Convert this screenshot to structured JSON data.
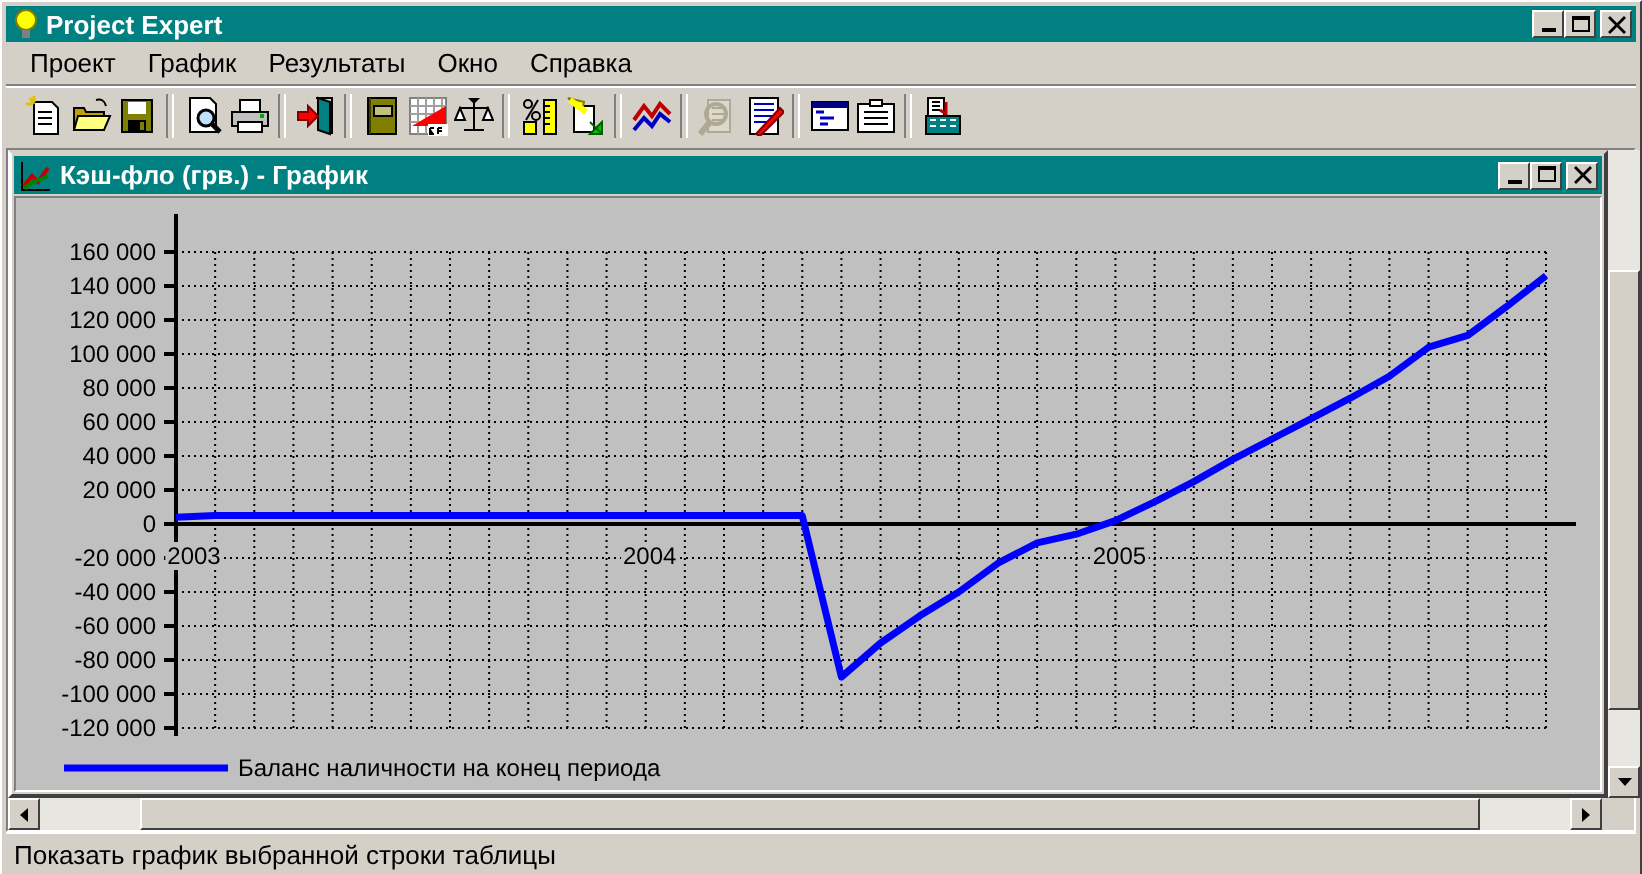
{
  "window": {
    "title": "Project Expert"
  },
  "menu": [
    "Проект",
    "График",
    "Результаты",
    "Окно",
    "Справка"
  ],
  "toolbar": [
    [
      {
        "kind": "new",
        "disabled": false
      },
      {
        "kind": "open",
        "disabled": false
      },
      {
        "kind": "save",
        "disabled": false
      }
    ],
    [
      {
        "kind": "preview",
        "disabled": false
      },
      {
        "kind": "print",
        "disabled": false
      }
    ],
    [
      {
        "kind": "exit",
        "disabled": false
      }
    ],
    [
      {
        "kind": "notebook",
        "disabled": false
      },
      {
        "kind": "gridchart",
        "disabled": false
      },
      {
        "kind": "scales",
        "disabled": false
      }
    ],
    [
      {
        "kind": "percent",
        "disabled": false
      },
      {
        "kind": "docarrow",
        "disabled": false
      }
    ],
    [
      {
        "kind": "linechart",
        "disabled": false
      }
    ],
    [
      {
        "kind": "finddoc",
        "disabled": true
      },
      {
        "kind": "editdoc",
        "disabled": false
      }
    ],
    [
      {
        "kind": "windows",
        "disabled": false
      },
      {
        "kind": "clipboard",
        "disabled": false
      }
    ],
    [
      {
        "kind": "calc",
        "disabled": false
      }
    ]
  ],
  "child_window": {
    "title": "Кэш-фло (грв.) - График",
    "chart_data": {
      "type": "line",
      "categories": [
        "2003",
        null,
        null,
        null,
        null,
        null,
        null,
        null,
        null,
        null,
        null,
        null,
        "2004",
        null,
        null,
        null,
        null,
        null,
        null,
        null,
        null,
        null,
        null,
        null,
        "2005",
        null,
        null,
        null,
        null,
        null,
        null,
        null,
        null,
        null,
        null,
        null
      ],
      "ylim": [
        -120000,
        160000
      ],
      "grid": true,
      "yticks": [
        {
          "value": 160000,
          "label": "160 000"
        },
        {
          "value": 140000,
          "label": "140 000"
        },
        {
          "value": 120000,
          "label": "120 000"
        },
        {
          "value": 100000,
          "label": "100 000"
        },
        {
          "value": 80000,
          "label": "80 000"
        },
        {
          "value": 60000,
          "label": "60 000"
        },
        {
          "value": 40000,
          "label": "40 000"
        },
        {
          "value": 20000,
          "label": "20 000"
        },
        {
          "value": 0,
          "label": "0"
        },
        {
          "value": -20000,
          "label": "-20 000"
        },
        {
          "value": -40000,
          "label": "-40 000"
        },
        {
          "value": -60000,
          "label": "-60 000"
        },
        {
          "value": -80000,
          "label": "-80 000"
        },
        {
          "value": -100000,
          "label": "-100 000"
        },
        {
          "value": -120000,
          "label": "-120 000"
        }
      ],
      "series": [
        {
          "name": "Баланс наличности на конец периода",
          "color": "#0000ff",
          "values": [
            4000,
            5000,
            5000,
            5000,
            5000,
            5000,
            5000,
            5000,
            5000,
            5000,
            5000,
            5000,
            5000,
            5000,
            5000,
            5000,
            5000,
            -90000,
            -70000,
            -54000,
            -40000,
            -23000,
            -11000,
            -6000,
            2000,
            13000,
            25000,
            38000,
            50000,
            62000,
            74000,
            87000,
            104000,
            111000,
            128000,
            146000
          ]
        }
      ]
    }
  },
  "status_bar": "Показать график выбранной строки таблицы"
}
